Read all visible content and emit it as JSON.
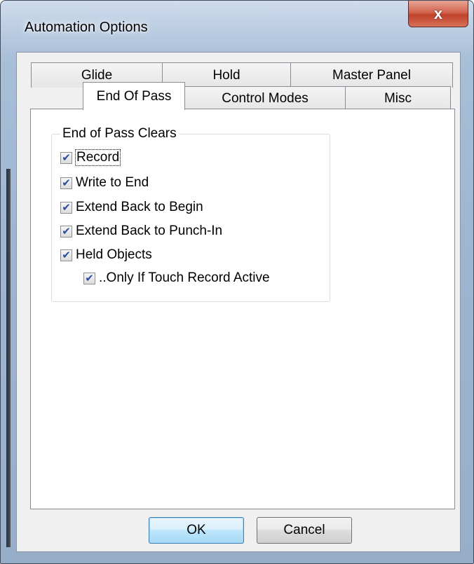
{
  "window": {
    "title": "Automation Options",
    "close_label": "x"
  },
  "tabs": {
    "row1": [
      {
        "label": "Glide"
      },
      {
        "label": "Hold"
      },
      {
        "label": "Master Panel"
      }
    ],
    "row2": [
      {
        "label": "End Of Pass",
        "selected": true
      },
      {
        "label": "Control Modes"
      },
      {
        "label": "Misc"
      }
    ]
  },
  "group": {
    "caption": "End of Pass Clears",
    "checkboxes": [
      {
        "label": "Record",
        "checked": true
      },
      {
        "label": "Write to End",
        "checked": true
      },
      {
        "label": "Extend Back to Begin",
        "checked": true
      },
      {
        "label": "Extend Back to Punch-In",
        "checked": true
      },
      {
        "label": "Held Objects",
        "checked": true
      },
      {
        "label": "..Only If Touch Record Active",
        "checked": true
      }
    ]
  },
  "buttons": {
    "ok": "OK",
    "cancel": "Cancel"
  },
  "check_glyph": "✔"
}
